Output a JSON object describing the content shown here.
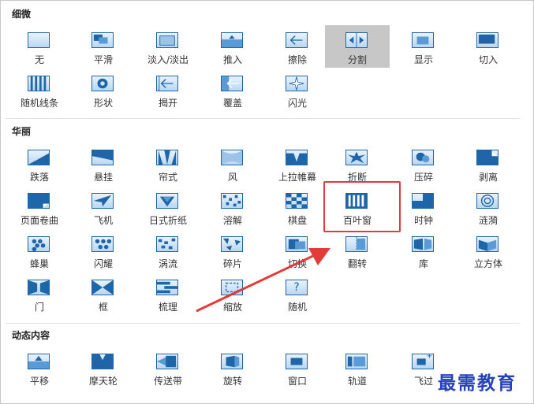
{
  "sections": [
    {
      "title": "细微",
      "items": [
        "无",
        "平滑",
        "淡入/淡出",
        "推入",
        "擦除",
        "分割",
        "显示",
        "切入",
        "随机线条",
        "形状",
        "揭开",
        "覆盖",
        "闪光"
      ]
    },
    {
      "title": "华丽",
      "items": [
        "跌落",
        "悬挂",
        "帘式",
        "风",
        "上拉帷幕",
        "折断",
        "压碎",
        "剥离",
        "页面卷曲",
        "飞机",
        "日式折纸",
        "溶解",
        "棋盘",
        "百叶窗",
        "时钟",
        "涟漪",
        "蜂巢",
        "闪耀",
        "涡流",
        "碎片",
        "切换",
        "翻转",
        "库",
        "立方体",
        "门",
        "框",
        "梳理",
        "缩放",
        "随机"
      ]
    },
    {
      "title": "动态内容",
      "items": [
        "平移",
        "摩天轮",
        "传送带",
        "旋转",
        "窗口",
        "轨道",
        "飞过"
      ]
    }
  ],
  "selected_item": "分割",
  "highlighted_item": "百叶窗",
  "random_icon_glyph": "?",
  "watermark": "最需教育",
  "colors": {
    "accent": "#1f66a8",
    "selected_bg": "#c7c7c7",
    "highlight": "#e33a3a",
    "watermark": "#2742b8"
  }
}
